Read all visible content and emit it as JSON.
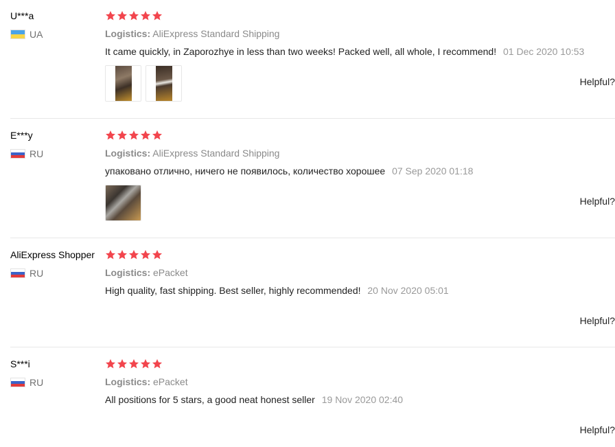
{
  "logistics_label": "Logistics:",
  "helpful_label": "Helpful?",
  "colors": {
    "star": "#f2454d",
    "date": "#999999",
    "logistics": "#8a8a8a"
  },
  "reviews": [
    {
      "user": "U***a",
      "country": "UA",
      "flag": "ukraine-flag",
      "rating": 5,
      "logistics": "AliExpress Standard Shipping",
      "text": "It came quickly, in Zaporozhye in less than two weeks! Packed well, all whole, I recommend!",
      "date": "01 Dec 2020 10:53",
      "photo_count": 2
    },
    {
      "user": "E***y",
      "country": "RU",
      "flag": "russia-flag",
      "rating": 5,
      "logistics": "AliExpress Standard Shipping",
      "text": "упаковано отлично, ничего не появилось, количество хорошее",
      "date": "07 Sep 2020 01:18",
      "photo_count": 1
    },
    {
      "user": "AliExpress Shopper",
      "country": "RU",
      "flag": "russia-flag",
      "rating": 5,
      "logistics": "ePacket",
      "text": "High quality, fast shipping. Best seller, highly recommended!",
      "date": "20 Nov 2020 05:01",
      "photo_count": 0
    },
    {
      "user": "S***i",
      "country": "RU",
      "flag": "russia-flag",
      "rating": 5,
      "logistics": "ePacket",
      "text": "All positions for 5 stars, a good neat honest seller",
      "date": "19 Nov 2020 02:40",
      "photo_count": 0
    }
  ]
}
